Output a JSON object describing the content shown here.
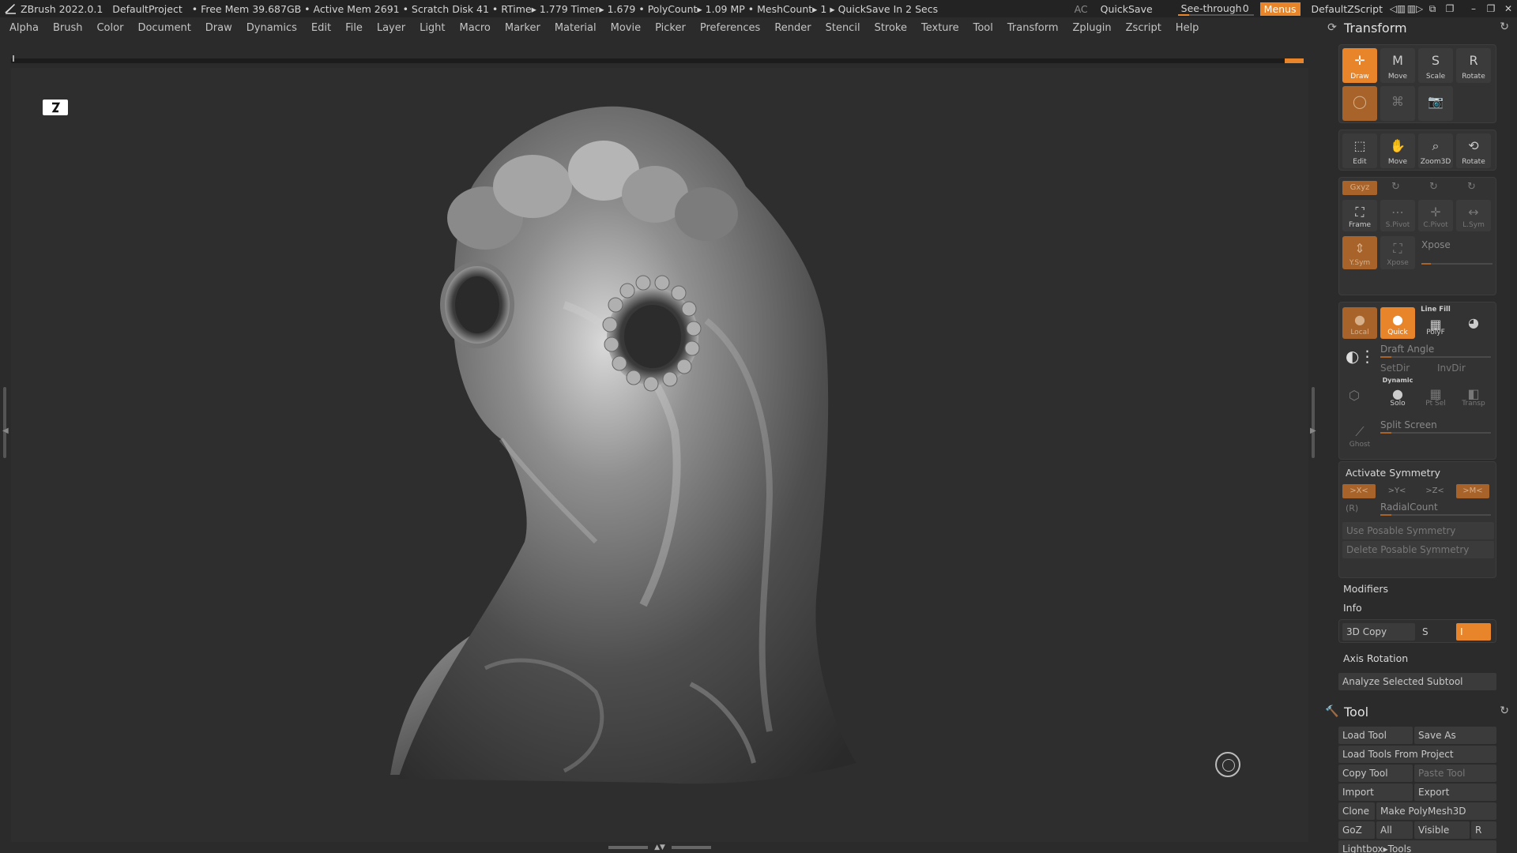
{
  "titlebar": {
    "app": "ZBrush 2022.0.1",
    "project": "DefaultProject",
    "stats": "• Free Mem 39.687GB • Active Mem 2691 • Scratch Disk 41 •  RTime▸ 1.779 Timer▸ 1.679 • PolyCount▸ 1.09 MP  • MeshCount▸ 1  ▸ QuickSave In 2 Secs",
    "ac": "AC",
    "quicksave": "QuickSave",
    "see_through_label": "See-through",
    "see_through_value": "0",
    "menus": "Menus",
    "script": "DefaultZScript"
  },
  "menubar": [
    "Alpha",
    "Brush",
    "Color",
    "Document",
    "Draw",
    "Dynamics",
    "Edit",
    "File",
    "Layer",
    "Light",
    "Macro",
    "Marker",
    "Material",
    "Movie",
    "Picker",
    "Preferences",
    "Render",
    "Stencil",
    "Stroke",
    "Texture",
    "Tool",
    "Transform",
    "Zplugin",
    "Zscript",
    "Help"
  ],
  "transform": {
    "title": "Transform",
    "draw": "Draw",
    "move": "Move",
    "scale": "Scale",
    "rotate": "Rotate",
    "edit": "Edit",
    "move2": "Move",
    "zoom3d": "Zoom3D",
    "rotate2": "Rotate",
    "xyz": "Gxyz",
    "frame": "Frame",
    "spivot": "S.Pivot",
    "cpivot": "C.Pivot",
    "lsym": "L.Sym",
    "vsym": "Y.Sym",
    "xpose_btn": "Xpose",
    "xpose_label": "Xpose",
    "local": "Local",
    "quick": "Quick",
    "line_fill": "Line Fill",
    "polyf": "PolyF",
    "draft_angle": "Draft Angle",
    "setdir": "SetDir",
    "invdir": "InvDir",
    "dynamic": "Dynamic",
    "solo": "Solo",
    "ptsel": "Pt Sel",
    "transp": "Transp",
    "ghost": "Ghost",
    "split_screen": "Split Screen",
    "activate_symmetry": "Activate Symmetry",
    "sym_x": ">X<",
    "sym_y": ">Y<",
    "sym_z": ">Z<",
    "sym_m": ">M<",
    "r_label": "(R)",
    "radial_count": "RadialCount",
    "use_posable": "Use Posable Symmetry",
    "delete_posable": "Delete Posable Symmetry",
    "modifiers": "Modifiers",
    "info": "Info",
    "copy3d": "3D Copy",
    "s_label": "S",
    "axis_rotation": "Axis Rotation",
    "analyze": "Analyze Selected Subtool"
  },
  "tool": {
    "title": "Tool",
    "load_tool": "Load Tool",
    "save_as": "Save As",
    "load_from_project": "Load Tools From Project",
    "copy_tool": "Copy Tool",
    "paste_tool": "Paste Tool",
    "import": "Import",
    "export": "Export",
    "clone": "Clone",
    "make_polymesh": "Make PolyMesh3D",
    "goz": "GoZ",
    "all": "All",
    "visible": "Visible",
    "r": "R",
    "lightbox_tools": "Lightbox▸Tools"
  },
  "icons": {
    "canvas_badge": "floor-grid-icon",
    "gizmo": "gizmo-icon"
  },
  "colors": {
    "accent": "#e8852a",
    "background": "#2b2b2b"
  }
}
